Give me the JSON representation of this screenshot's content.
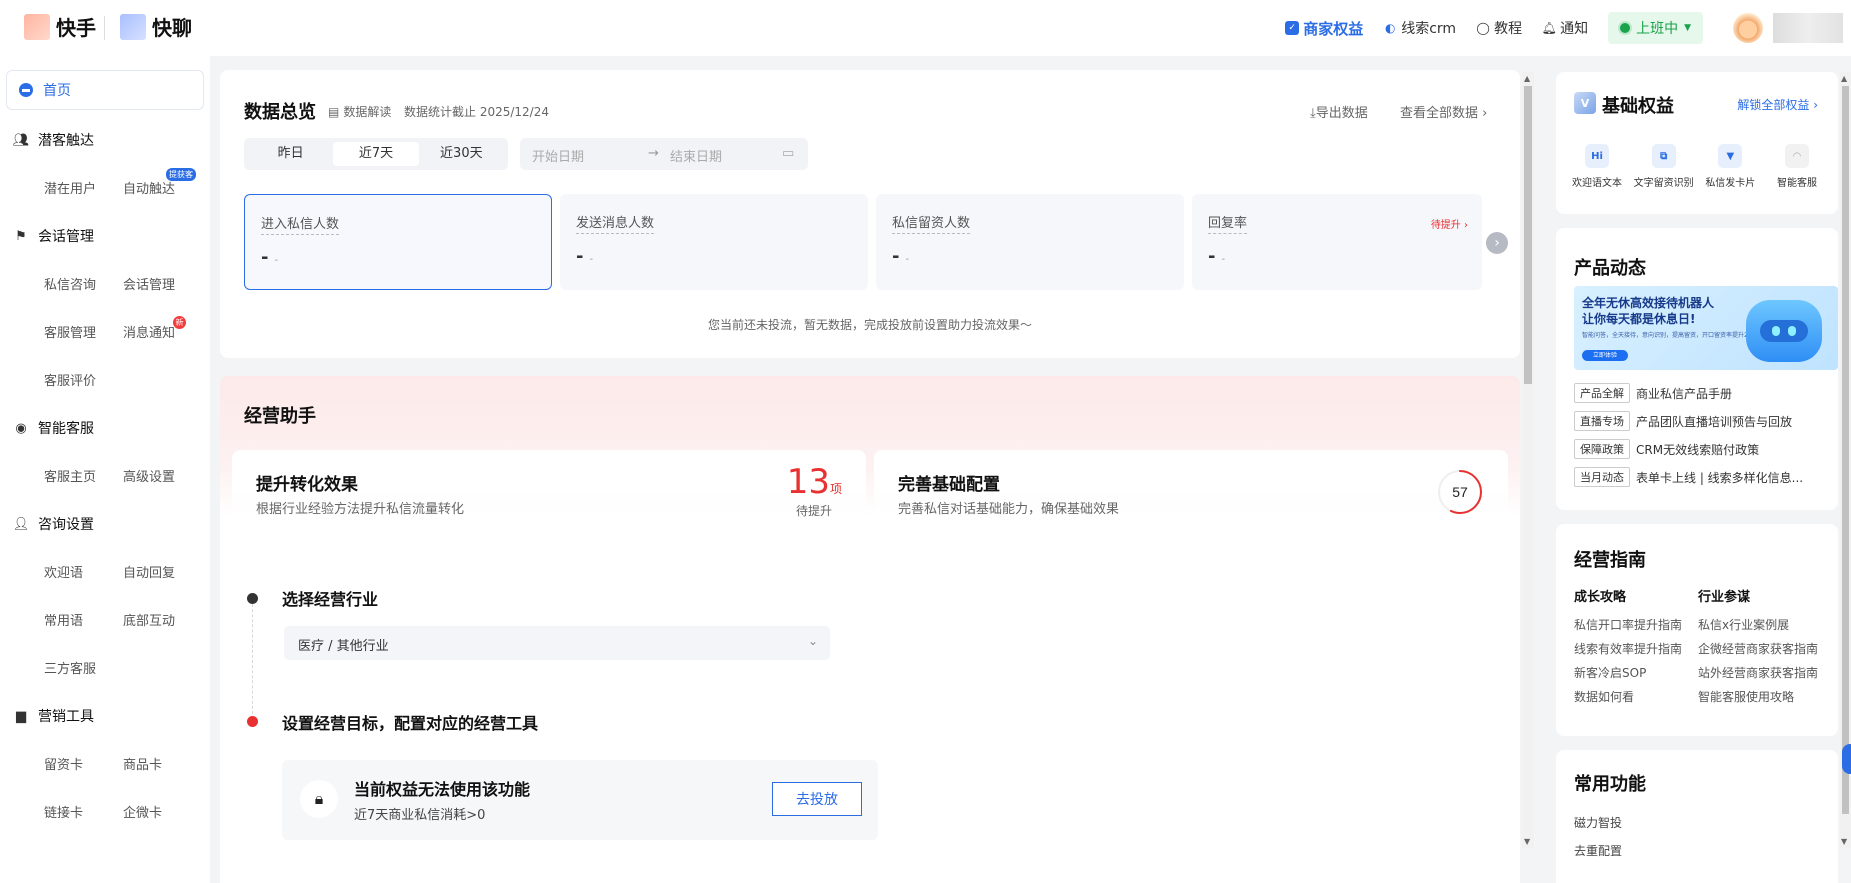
{
  "header": {
    "brand1": "快手",
    "brand2": "快聊",
    "nav": {
      "merchant": "商家权益",
      "crm": "线索crm",
      "tutorial": "教程",
      "notice": "通知"
    },
    "status": "上班中"
  },
  "sidebar": {
    "home": "首页",
    "groups": {
      "potential": "潜客触达",
      "session": "会话管理",
      "ai": "智能客服",
      "consult": "咨询设置",
      "marketing": "营销工具"
    },
    "items": {
      "potential_user": "潜在用户",
      "auto_reach": "自动触达",
      "auto_reach_badge": "提获客",
      "private_consult": "私信咨询",
      "session_manage": "会话管理",
      "cs_manage": "客服管理",
      "msg_notice": "消息通知",
      "msg_badge": "新",
      "cs_eval": "客服评价",
      "cs_home": "客服主页",
      "advanced": "高级设置",
      "welcome": "欢迎语",
      "auto_reply": "自动回复",
      "phrases": "常用语",
      "bottom_interact": "底部互动",
      "third_cs": "三方客服",
      "lead_card": "留资卡",
      "product_card": "商品卡",
      "link_card": "链接卡",
      "wecom_card": "企微卡"
    }
  },
  "overview": {
    "title": "数据总览",
    "interpret": "数据解读",
    "cutoff": "数据统计截止 2025/12/24",
    "export": "导出数据",
    "view_all": "查看全部数据",
    "tabs": [
      "昨日",
      "近7天",
      "近30天"
    ],
    "start_placeholder": "开始日期",
    "end_placeholder": "结束日期",
    "stats": [
      {
        "label": "进入私信人数",
        "value": "-",
        "sub": "-"
      },
      {
        "label": "发送消息人数",
        "value": "-",
        "sub": "-"
      },
      {
        "label": "私信留资人数",
        "value": "-",
        "sub": "-"
      },
      {
        "label": "回复率",
        "value": "-",
        "sub": "-",
        "tag": "待提升"
      }
    ],
    "empty": "您当前还未投流，暂无数据，完成投放前设置助力投流效果～"
  },
  "assistant": {
    "title": "经营助手",
    "card1": {
      "title": "提升转化效果",
      "desc": "根据行业经验方法提升私信流量转化",
      "num": "13",
      "unit": "项",
      "sub": "待提升"
    },
    "card2": {
      "title": "完善基础配置",
      "desc": "完善私信对话基础能力，确保基础效果",
      "score": "57",
      "score_pct": 0.57
    },
    "step1": "选择经营行业",
    "industry": "医疗 / 其他行业",
    "step2": "设置经营目标，配置对应的经营工具",
    "lock_title": "当前权益无法使用该功能",
    "lock_desc": "近7天商业私信消耗>0",
    "lock_btn": "去投放"
  },
  "rights": {
    "title": "基础权益",
    "unlock": "解锁全部权益",
    "items": [
      "欢迎语文本",
      "文字留资识别",
      "私信发卡片",
      "智能客服"
    ]
  },
  "product": {
    "title": "产品动态",
    "banner_line1": "全年无休高效接待机器人",
    "banner_line2": "让你每天都是休息日!",
    "banner_small": "智能问答，全天接待，意向识别，提高留资，开口留资率提升22%，负责率提升18%",
    "banner_btn": "立即体验",
    "rows": [
      {
        "tag": "产品全解",
        "text": "商业私信产品手册"
      },
      {
        "tag": "直播专场",
        "text": "产品团队直播培训预告与回放"
      },
      {
        "tag": "保障政策",
        "text": "CRM无效线索赔付政策"
      },
      {
        "tag": "当月动态",
        "text": "表单卡上线 | 线索多样化信息..."
      }
    ]
  },
  "guide": {
    "title": "经营指南",
    "col1_title": "成长攻略",
    "col1": [
      "私信开口率提升指南",
      "线索有效率提升指南",
      "新客冷启SOP",
      "数据如何看"
    ],
    "col2_title": "行业参谋",
    "col2": [
      "私信x行业案例展",
      "企微经营商家获客指南",
      "站外经营商家获客指南",
      "智能客服使用攻略"
    ]
  },
  "common": {
    "title": "常用功能",
    "items": [
      "磁力智投",
      "去重配置"
    ]
  }
}
